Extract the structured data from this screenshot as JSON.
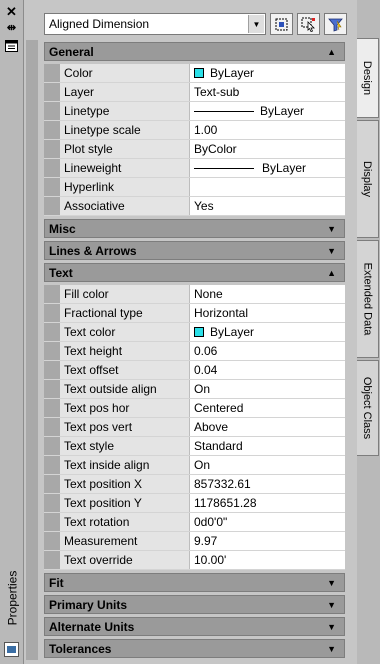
{
  "left_bar": {
    "title": "Properties"
  },
  "selector": {
    "value": "Aligned Dimension"
  },
  "categories": [
    {
      "title": "General",
      "expanded": true,
      "rows": [
        {
          "name": "Color",
          "value": "ByLayer",
          "swatch": "#2be0e8"
        },
        {
          "name": "Layer",
          "value": "Text-sub"
        },
        {
          "name": "Linetype",
          "value": "ByLayer",
          "line": "thin"
        },
        {
          "name": "Linetype scale",
          "value": "1.00"
        },
        {
          "name": "Plot style",
          "value": "ByColor"
        },
        {
          "name": "Lineweight",
          "value": "ByLayer",
          "line": "heavy"
        },
        {
          "name": "Hyperlink",
          "value": ""
        },
        {
          "name": "Associative",
          "value": "Yes"
        }
      ]
    },
    {
      "title": "Misc",
      "expanded": false,
      "rows": []
    },
    {
      "title": "Lines & Arrows",
      "expanded": false,
      "rows": []
    },
    {
      "title": "Text",
      "expanded": true,
      "rows": [
        {
          "name": "Fill color",
          "value": "None"
        },
        {
          "name": "Fractional type",
          "value": "Horizontal"
        },
        {
          "name": "Text color",
          "value": "ByLayer",
          "swatch": "#2be0e8"
        },
        {
          "name": "Text height",
          "value": "0.06"
        },
        {
          "name": "Text offset",
          "value": "0.04"
        },
        {
          "name": "Text outside align",
          "value": "On"
        },
        {
          "name": "Text pos hor",
          "value": "Centered"
        },
        {
          "name": "Text pos vert",
          "value": "Above"
        },
        {
          "name": "Text style",
          "value": "Standard"
        },
        {
          "name": "Text inside align",
          "value": "On"
        },
        {
          "name": "Text position X",
          "value": "857332.61"
        },
        {
          "name": "Text position Y",
          "value": "1178651.28"
        },
        {
          "name": "Text rotation",
          "value": "0d0'0\""
        },
        {
          "name": "Measurement",
          "value": "9.97"
        },
        {
          "name": "Text override",
          "value": "10.00'"
        }
      ]
    },
    {
      "title": "Fit",
      "expanded": false,
      "rows": []
    },
    {
      "title": "Primary Units",
      "expanded": false,
      "rows": []
    },
    {
      "title": "Alternate Units",
      "expanded": false,
      "rows": []
    },
    {
      "title": "Tolerances",
      "expanded": false,
      "rows": []
    }
  ],
  "tabs": [
    {
      "label": "Design",
      "active": true
    },
    {
      "label": "Display",
      "active": false
    },
    {
      "label": "Extended Data",
      "active": false
    },
    {
      "label": "Object Class",
      "active": false
    }
  ],
  "icons": {
    "close": "close-icon",
    "autohide": "autohide-icon",
    "menu": "properties-menu-icon",
    "quick_select": "quick-select-icon",
    "select_objects": "select-objects-icon",
    "pickadd": "pickadd-icon"
  }
}
